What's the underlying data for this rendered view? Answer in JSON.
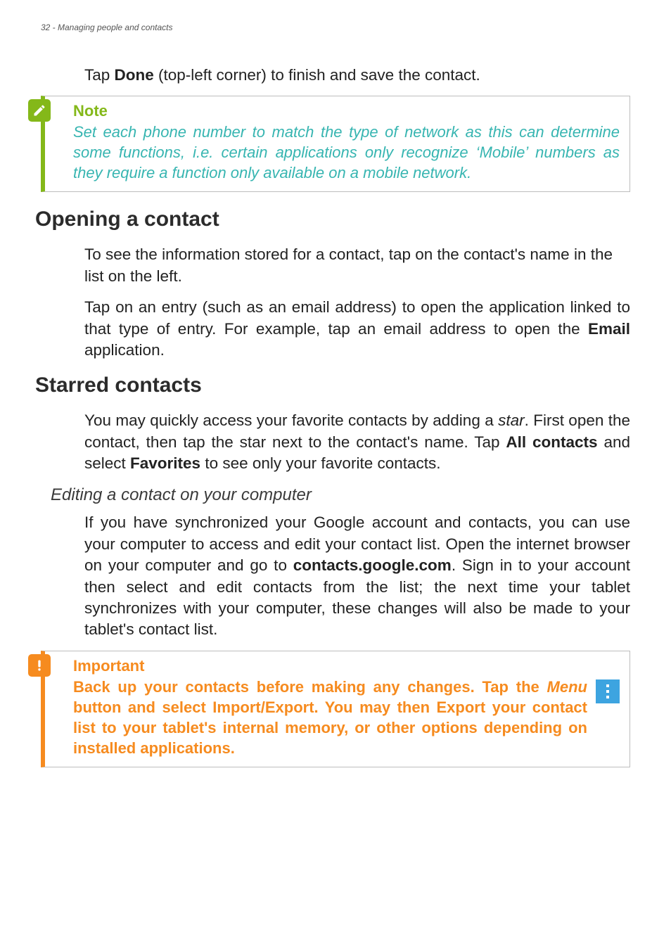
{
  "header": "32 - Managing people and contacts",
  "intro_parts": [
    "Tap ",
    "Done",
    " (top-left corner) to finish and save the contact."
  ],
  "note": {
    "title": "Note",
    "body": "Set each phone number to match the type of network as this can determine some functions, i.e. certain applications only recognize ‘Mobile’ numbers as they require a function only available on a mobile network.",
    "icon_name": "pencil-icon"
  },
  "section_open": {
    "title": "Opening a contact",
    "p1": "To see the information stored for a contact, tap on the contact's name in the list on the left.",
    "p2_parts": [
      "Tap on an entry (such as an email address) to open the application linked to that type of entry. For example, tap an email address to open the ",
      "Email",
      " application."
    ]
  },
  "section_star": {
    "title": "Starred contacts",
    "p1_parts": [
      "You may quickly access your favorite contacts by adding a ",
      "star",
      ". First open the contact, then tap the star next to the contact's name. Tap ",
      "All contacts",
      "  and select ",
      "Favorites",
      " to see only your favorite contacts."
    ]
  },
  "subsection_edit": {
    "title": "Editing a contact on your computer",
    "p1_parts": [
      "If you have synchronized your Google account and contacts, you can use your computer to access and edit your contact list. Open the internet browser on your computer and go to ",
      "contacts.google.com",
      ". Sign in to your account then select and edit contacts from the list; the next time your tablet synchronizes with your computer, these changes will also be made to your tablet's contact list."
    ]
  },
  "important": {
    "title": "Important",
    "body_parts": [
      "Back up your contacts before making any changes. Tap the ",
      "Menu",
      " button and select Import/Export. You may then Export your contact list to your tablet's internal memory, or other options depending on installed applications."
    ],
    "icon_name": "exclamation-icon",
    "menu_icon_name": "menu-dots-icon"
  }
}
